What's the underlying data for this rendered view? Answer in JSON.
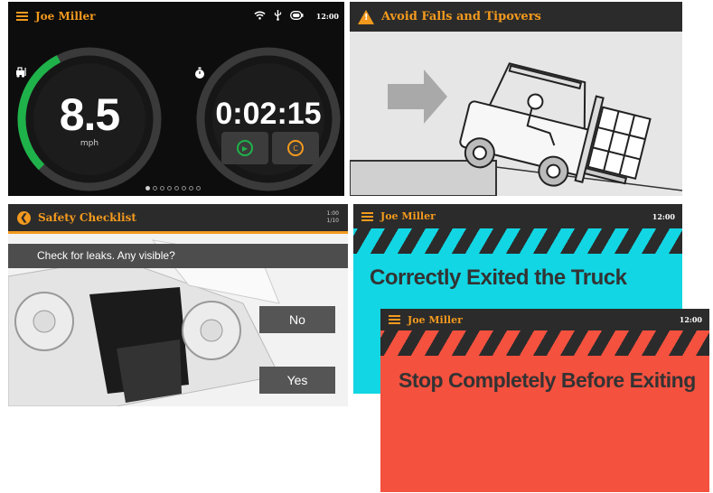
{
  "dashboard": {
    "operator_name": "Joe Miller",
    "status_icons": [
      "wifi-icon",
      "usb-icon",
      "battery-icon"
    ],
    "clock": "12:00",
    "speed": {
      "value": "8.5",
      "unit": "mph",
      "fill_fraction": 0.4
    },
    "timer": {
      "value": "0:02:15"
    },
    "page_dots": {
      "count": 8,
      "active": 1
    },
    "colors": {
      "speed_arc": "#1fb24a",
      "play": "#1fb24a",
      "clear": "#f39a1e"
    }
  },
  "falls": {
    "title": "Avoid Falls and Tipovers"
  },
  "checklist": {
    "title": "Safety Checklist",
    "progress_line1": "1:00",
    "progress_line2": "1/10",
    "question": "Check for leaks. Any visible?",
    "no_label": "No",
    "yes_label": "Yes"
  },
  "exited": {
    "operator_name": "Joe Miller",
    "clock": "12:00",
    "message": "Correctly Exited the Truck",
    "bg": "#12d6e3"
  },
  "stop": {
    "operator_name": "Joe Miller",
    "clock": "12:00",
    "message": "Stop Completely Before Exiting",
    "bg": "#f4513f"
  },
  "colors": {
    "accent": "#f39a1e",
    "bar": "#2b2b2b"
  }
}
